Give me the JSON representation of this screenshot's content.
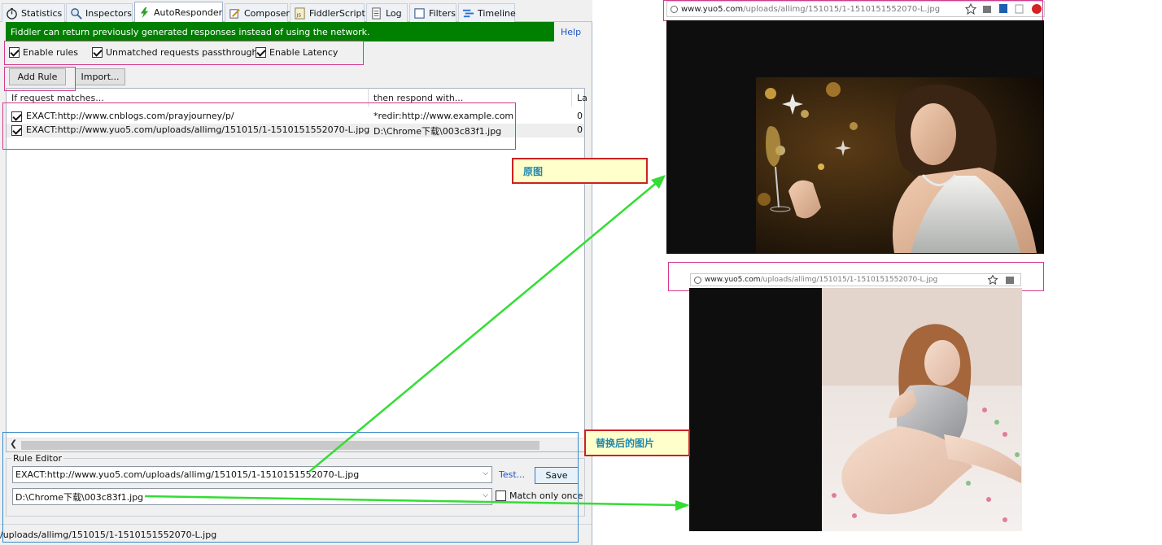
{
  "tabs": [
    {
      "label": "Statistics",
      "icon": "stopwatch-icon"
    },
    {
      "label": "Inspectors",
      "icon": "magnifier-icon"
    },
    {
      "label": "AutoResponder",
      "icon": "lightning-icon"
    },
    {
      "label": "Composer",
      "icon": "pencil-icon"
    },
    {
      "label": "FiddlerScript",
      "icon": "script-icon"
    },
    {
      "label": "Log",
      "icon": "log-icon"
    },
    {
      "label": "Filters",
      "icon": "filter-icon"
    },
    {
      "label": "Timeline",
      "icon": "timeline-icon"
    }
  ],
  "active_tab": "AutoResponder",
  "banner": {
    "text": "Fiddler can return previously generated responses instead of using the network.",
    "help": "Help",
    "color": "#008000"
  },
  "options": {
    "enable_rules": "Enable rules",
    "unmatched": "Unmatched requests passthrough",
    "latency": "Enable Latency"
  },
  "buttons": {
    "add_rule": "Add Rule",
    "import": "Import...",
    "test": "Test...",
    "save": "Save"
  },
  "columns": {
    "match": "If request matches...",
    "respond": "then respond with...",
    "latency": "La"
  },
  "rules": [
    {
      "match": "EXACT:http://www.cnblogs.com/prayjourney/p/",
      "respond": "*redir:http://www.example.com",
      "latency": "0",
      "checked": true
    },
    {
      "match": "EXACT:http://www.yuo5.com/uploads/allimg/151015/1-1510151552070-L.jpg",
      "respond": "D:\\Chrome下载\\003c83f1.jpg",
      "latency": "0",
      "checked": true
    }
  ],
  "rule_editor": {
    "title": "Rule Editor",
    "match_value": "EXACT:http://www.yuo5.com/uploads/allimg/151015/1-1510151552070-L.jpg",
    "response_value": "D:\\Chrome下载\\003c83f1.jpg",
    "match_only_once": "Match only once"
  },
  "status_bar": "/uploads/allimg/151015/1-1510151552070-L.jpg",
  "browser_top": {
    "host": "www.yuo5.com",
    "path": "/uploads/allimg/151015/1-1510151552070-L.jpg"
  },
  "browser_bottom": {
    "host": "www.yuo5.com",
    "path": "/uploads/allimg/151015/1-1510151552070-L.jpg"
  },
  "callouts": {
    "original": "原图",
    "replaced": "替换后的图片"
  },
  "colors": {
    "callout_border": "#cc2222",
    "callout_fill": "#ffffcc",
    "arrow": "#33dd33",
    "highlight": "#d23a8e"
  }
}
